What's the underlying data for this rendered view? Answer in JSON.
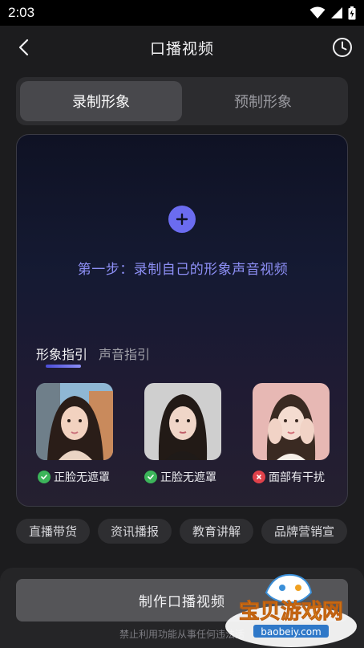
{
  "status_bar": {
    "time": "2:03"
  },
  "header": {
    "title": "口播视频"
  },
  "tabs": [
    {
      "label": "录制形象",
      "active": true
    },
    {
      "label": "预制形象",
      "active": false
    }
  ],
  "card": {
    "step_text": "第一步：录制自己的形象声音视频",
    "guide_tabs": [
      {
        "label": "形象指引",
        "active": true
      },
      {
        "label": "声音指引",
        "active": false
      }
    ],
    "examples": [
      {
        "label": "正脸无遮罩",
        "status": "ok",
        "status_icon": "check-circle-icon"
      },
      {
        "label": "正脸无遮罩",
        "status": "ok",
        "status_icon": "check-circle-icon"
      },
      {
        "label": "面部有干扰",
        "status": "bad",
        "status_icon": "x-circle-icon"
      }
    ]
  },
  "chips": [
    "直播带货",
    "资讯播报",
    "教育讲解",
    "品牌营销宣"
  ],
  "bottom": {
    "make_button": "制作口播视频",
    "disclaimer": "禁止利用功能从事任何违法活"
  },
  "watermark": {
    "text": "宝贝游戏网",
    "domain": "baobeiy.com"
  },
  "colors": {
    "accent": "#6b6cf0",
    "ok": "#3cb45a",
    "bad": "#e0414a",
    "background": "#1c1c1e"
  }
}
